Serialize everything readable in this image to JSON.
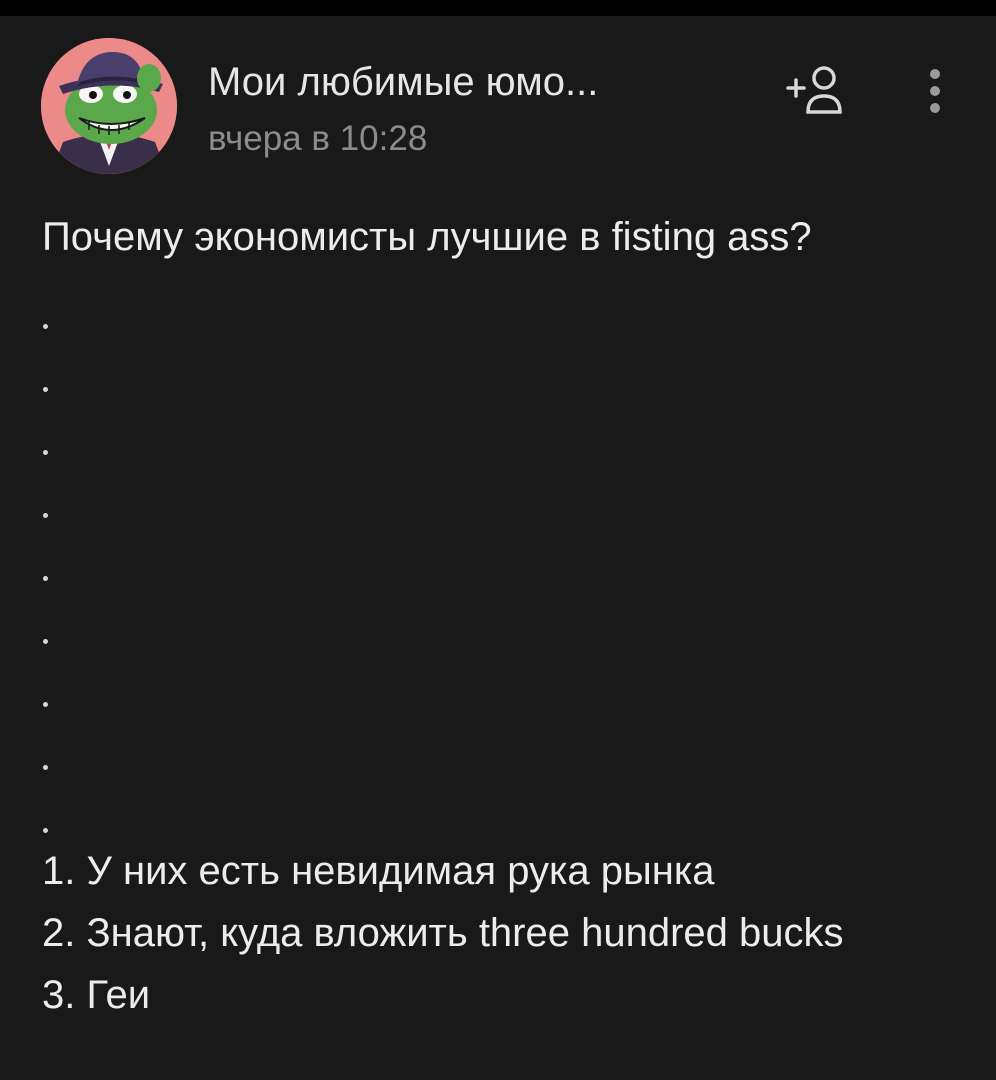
{
  "post": {
    "author": "Мои любимые юмо...",
    "time": "вчера в 10:28",
    "question": "Почему экономисты лучшие в fisting ass?",
    "separator": ".",
    "answers": [
      "1. У них есть невидимая рука рынка",
      "2. Знают, куда вложить three hundred bucks",
      "3. Геи"
    ]
  },
  "icons": {
    "avatar": "pepe-avatar-icon",
    "subscribe": "add-user-icon",
    "menu": "more-vertical-icon"
  },
  "colors": {
    "background": "#191919",
    "text": "#ececec",
    "secondary_text": "#8c8c8c",
    "avatar_bg": "#ec8a8a"
  }
}
